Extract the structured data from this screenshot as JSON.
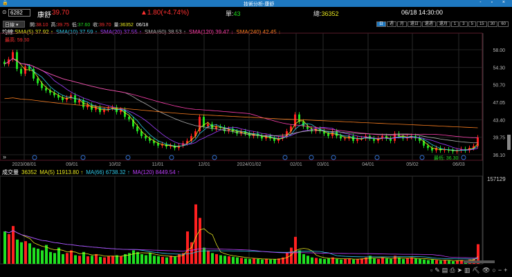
{
  "window": {
    "title": "技術分析-康舒",
    "controls": "- ▫ ×"
  },
  "header": {
    "code": "6282",
    "name": "康舒",
    "price": "39.70",
    "change": "▲1.80(+4.74%)",
    "single_label": "單:",
    "single": "43",
    "total_label": "總:",
    "total": "36352",
    "datetime": "06/18 14:30:00"
  },
  "ohlc": {
    "period": "日線",
    "open_label": "開:",
    "open": "38.10",
    "high_label": "高:",
    "high": "39.75",
    "low_label": "低:",
    "low": "37.60",
    "close_label": "收:",
    "close": "39.70",
    "vol_label": "量:",
    "vol": "36352",
    "date": "06/18"
  },
  "periods": [
    "日",
    "週",
    "月",
    "還日",
    "還週",
    "還月",
    "1",
    "3",
    "5",
    "15",
    "30",
    "60"
  ],
  "ma_legend": {
    "label": "均線:",
    "items": [
      {
        "text": "SMA(5) 37.92 ↑",
        "color": "#e8e820"
      },
      {
        "text": "SMA(10) 37.59 ↑",
        "color": "#30c8e8"
      },
      {
        "text": "SMA(20) 37.55 ↑",
        "color": "#a040ff"
      },
      {
        "text": "SMA(60) 38.53 ↑",
        "color": "#b0b0b0"
      },
      {
        "text": "SMA(120) 39.47 ↓",
        "color": "#ff40b0"
      },
      {
        "text": "SMA(240) 42.45 ↓",
        "color": "#ff8020"
      }
    ]
  },
  "annotations": {
    "highest": "最高: 59.50",
    "lowest": "最低: 36.30"
  },
  "price_axis": [
    "58.00",
    "54.30",
    "50.70",
    "47.05",
    "43.40",
    "39.75",
    "36.10"
  ],
  "date_axis": [
    "2023/08/01",
    "09/01",
    "10/02",
    "11/01",
    "12/01",
    "2024/01/02",
    "02/01",
    "03/01",
    "04/01",
    "05/02",
    "06/03"
  ],
  "vol_legend": {
    "label": "成交量",
    "vol": "36352",
    "items": [
      {
        "text": "MA(5) 11913.80 ↑",
        "color": "#e8e820"
      },
      {
        "text": "MA(66) 6738.32 ↑",
        "color": "#30c8e8"
      },
      {
        "text": "MA(120) 8449.54 ↑",
        "color": "#c040ff"
      }
    ]
  },
  "vol_axis": "157129",
  "chart_data": {
    "type": "candlestick",
    "ylim": [
      35.5,
      59.5
    ],
    "vol_max": 157129,
    "closes": [
      55,
      56,
      57.5,
      54,
      53,
      54.5,
      54,
      52,
      51,
      50,
      49.5,
      49,
      48.5,
      48,
      47.5,
      48,
      48.5,
      47,
      47.5,
      46,
      46.5,
      45.5,
      46,
      45,
      45.5,
      45.8,
      46,
      45,
      45.5,
      44,
      43.5,
      42,
      41,
      40,
      39.5,
      39,
      38.5,
      38,
      38.3,
      37.8,
      38,
      37.5,
      38,
      38.5,
      39,
      40,
      41,
      44,
      42,
      42.5,
      41.5,
      42,
      41.8,
      41,
      41.5,
      41,
      40.5,
      41,
      40.5,
      40,
      40.5,
      40,
      39.5,
      40,
      39.5,
      39,
      39.5,
      40,
      41,
      42,
      44.5,
      43,
      42,
      41.5,
      41,
      41.5,
      41,
      40.5,
      40,
      41,
      40,
      39.5,
      39.5,
      40,
      39,
      39.5,
      39.5,
      40,
      39.5,
      39,
      39.5,
      40,
      39.5,
      39,
      40.5,
      40,
      39.5,
      39.8,
      40,
      39.5,
      39,
      38,
      37.5,
      37,
      37.5,
      37,
      37.2,
      37,
      36.8,
      37,
      37.3,
      37,
      37.5,
      37.9,
      39.7
    ],
    "volumes": [
      60000,
      55000,
      70000,
      45000,
      40000,
      42000,
      38000,
      30000,
      28000,
      25000,
      35000,
      22000,
      20000,
      30000,
      18000,
      20000,
      25000,
      16000,
      15000,
      22000,
      14000,
      15000,
      18000,
      13000,
      12000,
      14000,
      15000,
      16000,
      14000,
      18000,
      20000,
      25000,
      22000,
      18000,
      16000,
      20000,
      15000,
      14000,
      13000,
      12000,
      15000,
      14000,
      18000,
      20000,
      60000,
      40000,
      110000,
      85000,
      30000,
      25000,
      20000,
      18000,
      16000,
      15000,
      14000,
      13000,
      12000,
      11000,
      10000,
      9000,
      10000,
      9000,
      8000,
      9000,
      8000,
      9000,
      10000,
      12000,
      20000,
      30000,
      50000,
      25000,
      18000,
      15000,
      12000,
      11000,
      10000,
      9000,
      10000,
      12000,
      9000,
      8000,
      9000,
      10000,
      8000,
      9000,
      10000,
      12000,
      15000,
      10000,
      9000,
      12000,
      10000,
      9000,
      15000,
      11000,
      9000,
      10000,
      12000,
      10000,
      9000,
      8000,
      7000,
      8000,
      7000,
      6000,
      7000,
      6000,
      5000,
      6000,
      7000,
      6000,
      8000,
      10000,
      36352
    ]
  },
  "toolbar": [
    "▫",
    "✎",
    "▤",
    "⎙",
    "➤",
    "▥",
    "⛏",
    "👁",
    "○",
    "−",
    "+"
  ]
}
